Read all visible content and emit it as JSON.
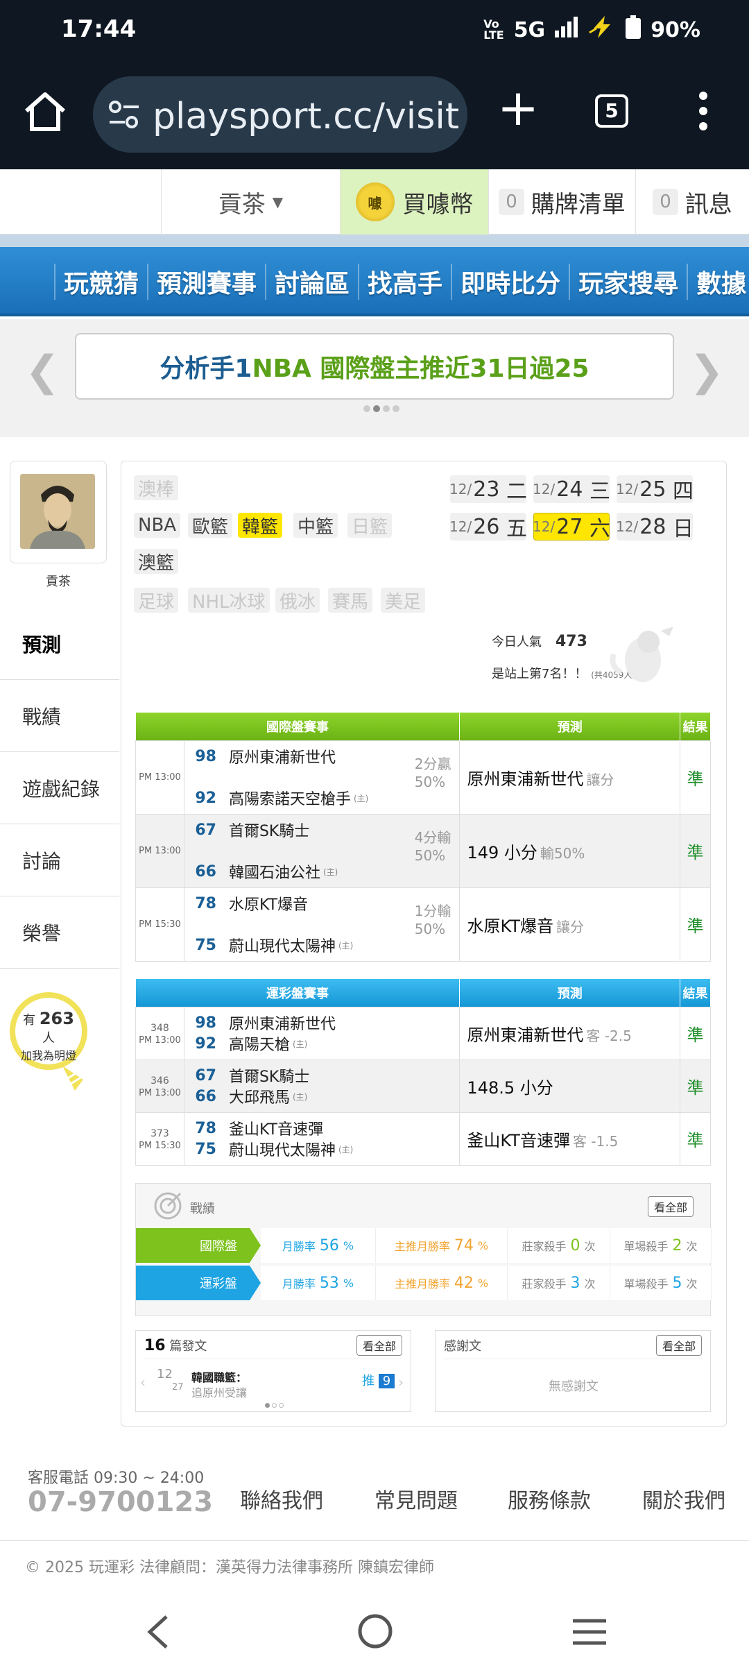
{
  "status": {
    "time": "17:44",
    "network": "5G",
    "battery": "90%"
  },
  "browser": {
    "url": "playsport.cc/visit",
    "tab_count": "5"
  },
  "header": {
    "user": "貢茶",
    "coin_label": "買噱幣",
    "coin_icon_text": "噱",
    "cart_count": "0",
    "cart_label": "購牌清單",
    "msg_count": "0",
    "msg_label": "訊息"
  },
  "nav": [
    "玩競猜",
    "預測賽事",
    "討論區",
    "找高手",
    "即時比分",
    "玩家搜尋",
    "數據"
  ],
  "banner": {
    "part1": "分析手1 ",
    "part2": "NBA 國際盤主推近31日過25"
  },
  "profile": {
    "name": "貢茶"
  },
  "sidemenu": [
    "預測",
    "戰績",
    "遊戲紀錄",
    "討論",
    "榮譽"
  ],
  "fans": {
    "prefix": "有",
    "count": "263",
    "suffix": "人",
    "line2": "加我為明燈"
  },
  "sports": {
    "row1": [
      "澳棒"
    ],
    "row2": [
      "NBA",
      "歐籃",
      "韓籃",
      "中籃",
      "日籃"
    ],
    "row3": [
      "澳籃"
    ],
    "row4": [
      "足球",
      "NHL冰球",
      "俄冰",
      "賽馬",
      "美足"
    ]
  },
  "dates": [
    {
      "m": "12/",
      "d": "23",
      "w": "二"
    },
    {
      "m": "12/",
      "d": "24",
      "w": "三"
    },
    {
      "m": "12/",
      "d": "25",
      "w": "四"
    },
    {
      "m": "12/",
      "d": "26",
      "w": "五"
    },
    {
      "m": "12/",
      "d": "27",
      "w": "六"
    },
    {
      "m": "12/",
      "d": "28",
      "w": "日"
    }
  ],
  "popularity": {
    "label": "今日人氣",
    "value": "473",
    "rank": "是站上第7名！！",
    "total": "(共4059人)"
  },
  "intl": {
    "headers": [
      "國際盤賽事",
      "預測",
      "結果"
    ],
    "rows": [
      {
        "time": "PM 13:00",
        "s1": "98",
        "t1": "原州東浦新世代",
        "s2": "92",
        "t2": "高陽索諾天空槍手",
        "host": "(主)",
        "h1": "2分贏",
        "h2": "50%",
        "pred": "原州東浦新世代",
        "pred_g": "讓分",
        "res": "準"
      },
      {
        "time": "PM 13:00",
        "s1": "67",
        "t1": "首爾SK騎士",
        "s2": "66",
        "t2": "韓國石油公社",
        "host": "(主)",
        "h1": "4分輸",
        "h2": "50%",
        "pred": "149 小分",
        "pred_g": "輸50%",
        "res": "準"
      },
      {
        "time": "PM 15:30",
        "s1": "78",
        "t1": "水原KT爆音",
        "s2": "75",
        "t2": "蔚山現代太陽神",
        "host": "(主)",
        "h1": "1分輸",
        "h2": "50%",
        "pred": "水原KT爆音",
        "pred_g": "讓分",
        "res": "準"
      }
    ]
  },
  "lottery": {
    "headers": [
      "運彩盤賽事",
      "預測",
      "結果"
    ],
    "rows": [
      {
        "num": "348",
        "time": "PM 13:00",
        "s1": "98",
        "t1": "原州東浦新世代",
        "s2": "92",
        "t2": "高陽天槍",
        "host": "(主)",
        "pred": "原州東浦新世代",
        "pred_g": "客 -2.5",
        "res": "準"
      },
      {
        "num": "346",
        "time": "PM 13:00",
        "s1": "67",
        "t1": "首爾SK騎士",
        "s2": "66",
        "t2": "大邱飛馬",
        "host": "(主)",
        "pred": "148.5 小分",
        "pred_g": "",
        "res": "準"
      },
      {
        "num": "373",
        "time": "PM 15:30",
        "s1": "78",
        "t1": "釜山KT音速彈",
        "s2": "75",
        "t2": "蔚山現代太陽神",
        "host": "(主)",
        "pred": "釜山KT音速彈",
        "pred_g": "客 -1.5",
        "res": "準"
      }
    ]
  },
  "record": {
    "title": "戰績",
    "see_all": "看全部",
    "rows": [
      {
        "label": "國際盤",
        "c1l": "月勝率",
        "c1v": "56",
        "c1u": "%",
        "c2l": "主推月勝率",
        "c2v": "74",
        "c2u": "%",
        "c3l": "莊家殺手",
        "c3v": "0",
        "c3u": "次",
        "c4l": "單場殺手",
        "c4v": "2",
        "c4u": "次"
      },
      {
        "label": "運彩盤",
        "c1l": "月勝率",
        "c1v": "53",
        "c1u": "%",
        "c2l": "主推月勝率",
        "c2v": "42",
        "c2u": "%",
        "c3l": "莊家殺手",
        "c3v": "3",
        "c3u": "次",
        "c4l": "單場殺手",
        "c4v": "5",
        "c4u": "次"
      }
    ]
  },
  "posts": {
    "count": "16",
    "label": "篇發文",
    "see_all": "看全部",
    "date_m": "12",
    "date_d": "27",
    "title": "韓國職籃：",
    "sub": "追原州受讓",
    "push_label": "推",
    "push_count": "9"
  },
  "thanks": {
    "label": "感謝文",
    "see_all": "看全部",
    "empty": "無感謝文"
  },
  "footer": {
    "service_label": "客服電話 09:30 ~ 24:00",
    "phone": "07-9700123",
    "links": [
      "聯絡我們",
      "常見問題",
      "服務條款",
      "關於我們"
    ],
    "copyright": "© 2025 玩運彩 法律顧問：漢英得力法律事務所 陳鎮宏律師"
  },
  "colors": {
    "green": "#7dc21d",
    "blue": "#1ea4e3",
    "nav_blue": "#1f78c1"
  }
}
